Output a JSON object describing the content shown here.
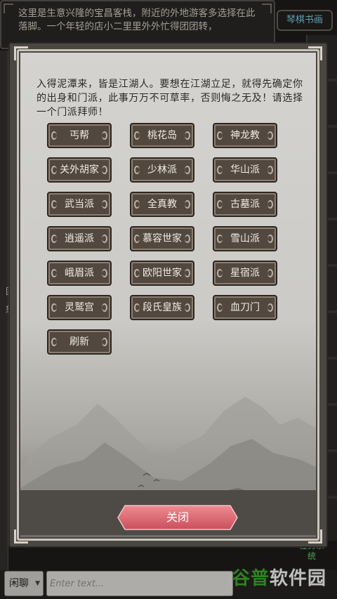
{
  "story": {
    "text": "这里是生意兴隆的宝昌客栈，附近的外地游客多选择在此落脚。一个年轻的店小二里里外外忙得团团转，"
  },
  "right_tab": {
    "label": "琴棋书画"
  },
  "side_labels": [
    "团",
    "怒"
  ],
  "task_label": "任务系统",
  "dialog": {
    "intro": "入得泥潭来，皆是江湖人。要想在江湖立足，就得先确定你的出身和门派，此事万万不可草率，否则悔之无及！请选择一个门派拜师！",
    "sects": [
      "丐帮",
      "桃花岛",
      "神龙教",
      "关外胡家",
      "少林派",
      "华山派",
      "武当派",
      "全真教",
      "古墓派",
      "逍遥派",
      "慕容世家",
      "雪山派",
      "峨眉派",
      "欧阳世家",
      "星宿派",
      "灵鹫宫",
      "段氏皇族",
      "血刀门"
    ],
    "refresh_label": "刷新",
    "close_label": "关闭"
  },
  "chat": {
    "channel": "闲聊",
    "placeholder": "Enter text..."
  },
  "watermark": {
    "part1": "谷普",
    "part2": "软件园"
  },
  "colors": {
    "button_bg": "#52483f",
    "button_text": "#f1ebe0",
    "close_button": "#e0626e",
    "tab_text": "#7fd3e8",
    "task_text": "#62d36a",
    "watermark_green": "#3cae2c"
  }
}
